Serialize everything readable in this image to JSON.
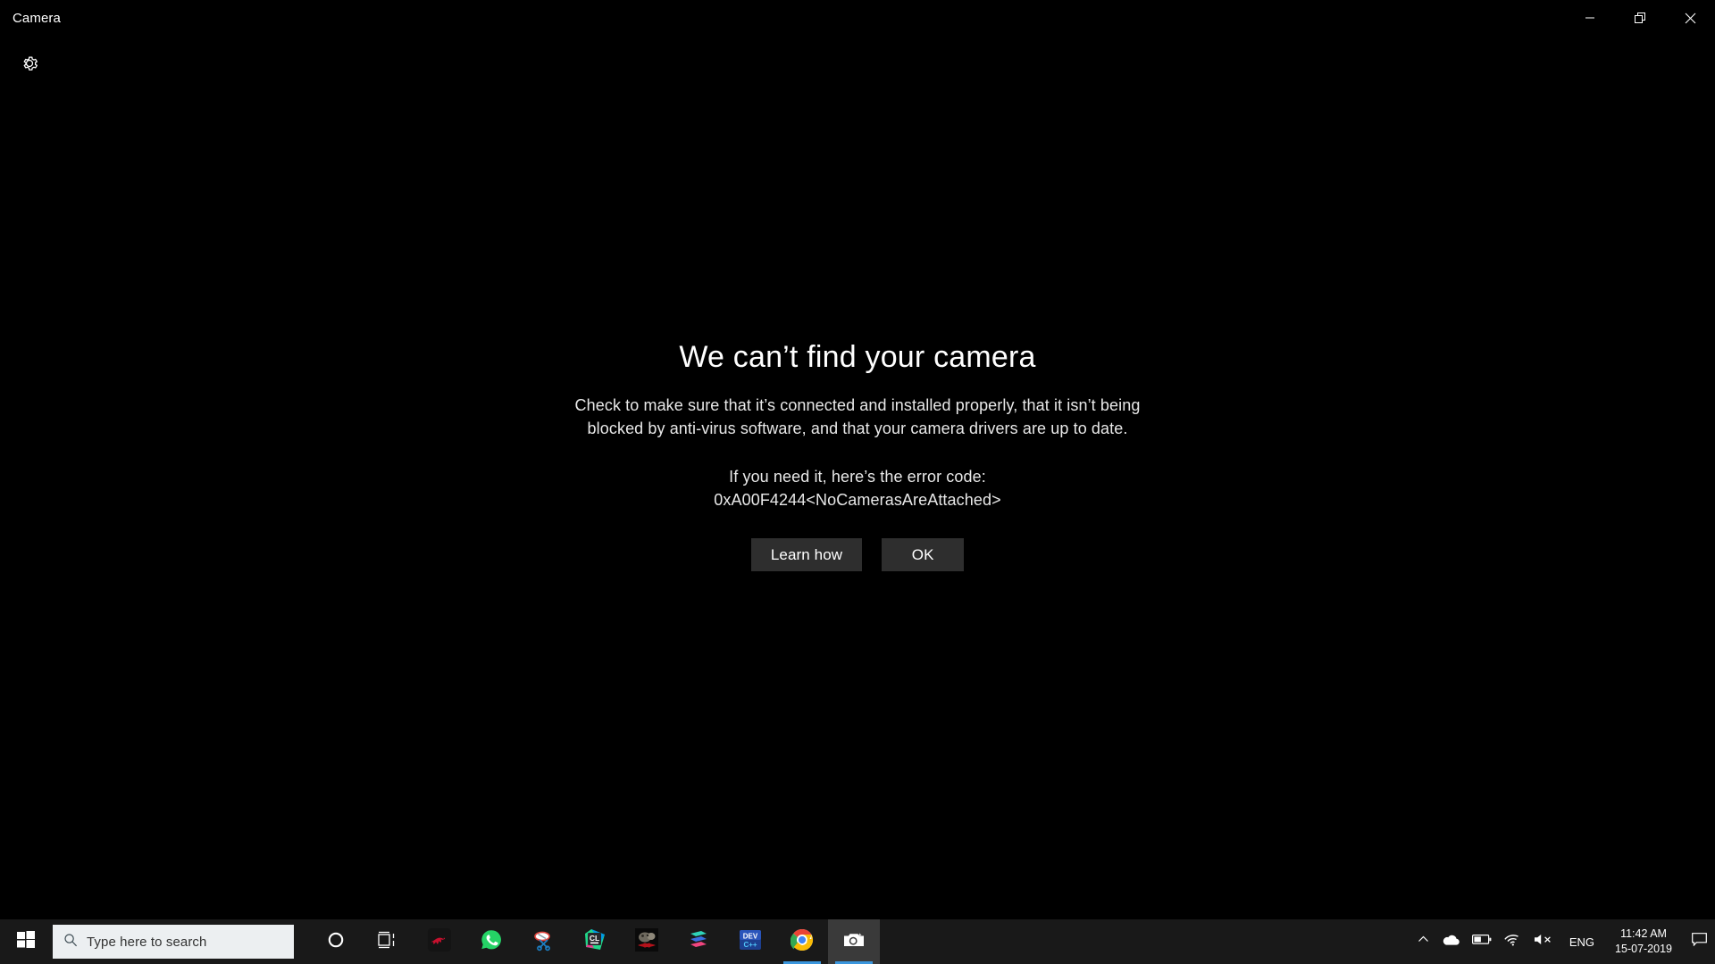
{
  "window": {
    "title": "Camera",
    "controls": [
      {
        "name": "minimize-button",
        "icon": "minimize-icon"
      },
      {
        "name": "restore-button",
        "icon": "restore-icon"
      },
      {
        "name": "close-button",
        "icon": "close-icon"
      }
    ],
    "settings_icon": "gear-icon"
  },
  "error": {
    "heading": "We can’t find your camera",
    "body": "Check to make sure that it’s connected and installed properly, that it isn’t being blocked by anti-virus software, and that your camera drivers are up to date.",
    "code_intro": "If you need it, here’s the error code:",
    "code": "0xA00F4244<NoCamerasAreAttached>",
    "learn_how_label": "Learn how",
    "ok_label": "OK"
  },
  "taskbar": {
    "start_icon": "windows-logo-icon",
    "search": {
      "icon": "search-icon",
      "placeholder": "Type here to search",
      "value": ""
    },
    "pinned": [
      {
        "name": "cortana",
        "label": "Cortana",
        "icon": "cortana-circle-icon",
        "active": false,
        "running": false
      },
      {
        "name": "task-view",
        "label": "Task View",
        "icon": "task-view-icon",
        "active": false,
        "running": false
      },
      {
        "name": "dragon-center",
        "label": "MSI Dragon Center",
        "icon": "dragon-icon",
        "active": false,
        "running": false
      },
      {
        "name": "whatsapp",
        "label": "WhatsApp",
        "icon": "whatsapp-icon",
        "active": false,
        "running": false
      },
      {
        "name": "snipping-tool",
        "label": "Snipping Tool",
        "icon": "scissors-icon",
        "active": false,
        "running": false
      },
      {
        "name": "clion",
        "label": "CLion",
        "icon": "clion-icon",
        "active": false,
        "running": false
      },
      {
        "name": "game",
        "label": "Game",
        "icon": "game-icon",
        "active": false,
        "running": false
      },
      {
        "name": "layers-app",
        "label": "Layers App",
        "icon": "layers-icon",
        "active": false,
        "running": false
      },
      {
        "name": "dev-cpp",
        "label": "Dev-C++",
        "icon": "dev-cpp-icon",
        "active": false,
        "running": false
      },
      {
        "name": "chrome",
        "label": "Google Chrome",
        "icon": "chrome-icon",
        "active": false,
        "running": true
      },
      {
        "name": "camera",
        "label": "Camera",
        "icon": "camera-icon",
        "active": true,
        "running": true
      }
    ],
    "tray": {
      "show_hidden_icon": "chevron-up-icon",
      "onedrive_icon": "cloud-icon",
      "battery_icon": "battery-icon",
      "network_icon": "wifi-icon",
      "volume_icon": "speaker-muted-icon",
      "language": "ENG",
      "time": "11:42 AM",
      "date": "15-07-2019",
      "action_center_icon": "action-center-icon"
    }
  },
  "colors": {
    "accent": "#3a96dd",
    "taskbar_bg": "#191919",
    "button_bg": "#2e2e2e",
    "app_bg": "#000000"
  }
}
